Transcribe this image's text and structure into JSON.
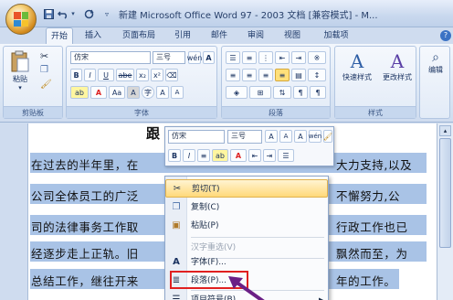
{
  "window": {
    "title": "新建 Microsoft Office Word 97 - 2003 文档 [兼容模式] - M..."
  },
  "quick_access": {
    "save": "save-icon",
    "undo": "undo-icon",
    "redo": "redo-icon"
  },
  "tabs": [
    {
      "label": "开始",
      "active": true
    },
    {
      "label": "插入"
    },
    {
      "label": "页面布局"
    },
    {
      "label": "引用"
    },
    {
      "label": "邮件"
    },
    {
      "label": "审阅"
    },
    {
      "label": "视图"
    },
    {
      "label": "加载项"
    }
  ],
  "ribbon": {
    "clipboard": {
      "label": "剪贴板",
      "paste": "粘贴"
    },
    "font": {
      "label": "字体",
      "name": "仿宋",
      "size": "三号",
      "bold": "B",
      "italic": "I",
      "underline": "U",
      "strike": "abe",
      "sub": "x₂",
      "sup": "x²",
      "grow": "A",
      "shrink": "A",
      "clear": "Aa",
      "wen": "wén",
      "charborder": "A"
    },
    "paragraph": {
      "label": "段落"
    },
    "styles": {
      "label": "样式",
      "quick": "快速样式",
      "change": "更改样式"
    },
    "editing": {
      "label": "编辑"
    }
  },
  "document": {
    "heading": "跟",
    "lines": [
      "在过去的半年里，在",
      "公司全体员工的广泛",
      "司的法律事务工作取",
      "经逐步走上正轨。旧",
      "总结工作，继往开来"
    ],
    "lines_right": [
      "大力支持,以及",
      "不懈努力,公",
      "行政工作也已",
      "飘然而至，为",
      "年的工作。"
    ]
  },
  "mini_toolbar": {
    "font": "仿宋",
    "size": "三号",
    "bold": "B",
    "italic": "I"
  },
  "context_menu": {
    "items": [
      {
        "label": "剪切(T)",
        "icon": "scissors-icon",
        "highlight": true
      },
      {
        "label": "复制(C)",
        "icon": "copy-icon"
      },
      {
        "label": "粘贴(P)",
        "icon": "paste-icon"
      },
      {
        "label": "汉字重选(V)",
        "disabled": true
      },
      {
        "label": "字体(F)...",
        "icon": "font-icon"
      },
      {
        "label": "段落(P)...",
        "icon": "paragraph-icon",
        "boxed": true
      },
      {
        "label": "项目符号(B)",
        "icon": "bullets-icon",
        "submenu": true
      }
    ]
  },
  "colors": {
    "selection": "#a9c3e6",
    "highlight_box": "#e02020",
    "arrow": "#6b1f86"
  }
}
